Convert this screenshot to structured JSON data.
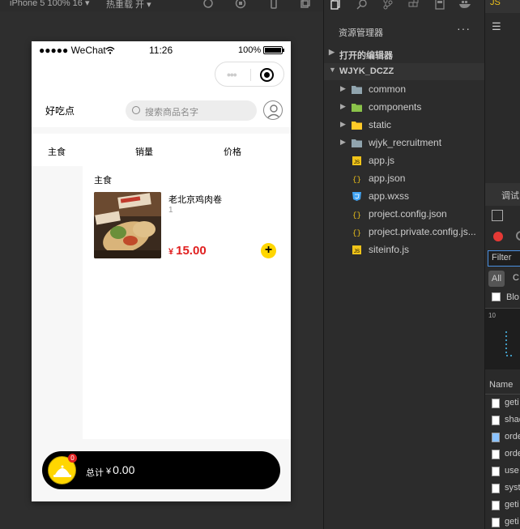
{
  "simulator": {
    "device_label": "iPhone 5 100% 16 ▾",
    "hot_reload_label": "热重载 开 ▾"
  },
  "phone": {
    "status": {
      "carrier": "●●●●● WeChat",
      "time": "11:26",
      "battery": "100%",
      "battery_level": 1.0
    },
    "header": {
      "brand": "好吃点",
      "search_placeholder": "搜索商品名字"
    },
    "sort_tabs": [
      "主食",
      "销量",
      "价格"
    ],
    "category_title": "主食",
    "item": {
      "name": "老北京鸡肉卷",
      "sales": "1",
      "currency": "¥",
      "price": "15.00",
      "add_label": "+"
    },
    "cart": {
      "badge": "0",
      "total_label": "总计",
      "currency": "¥",
      "total": "0.00"
    }
  },
  "explorer": {
    "title": "资源管理器",
    "more": "···",
    "open_editors": "打开的编辑器",
    "project": "WJYK_DCZZ",
    "tree": [
      {
        "label": "common",
        "type": "folder",
        "icon_color": "#90a4ae"
      },
      {
        "label": "components",
        "type": "folder",
        "icon_color": "#8bc34a"
      },
      {
        "label": "static",
        "type": "folder",
        "icon_color": "#ffca28"
      },
      {
        "label": "wjyk_recruitment",
        "type": "folder",
        "icon_color": "#90a4ae"
      },
      {
        "label": "app.js",
        "type": "js",
        "icon_color": "#f0c419"
      },
      {
        "label": "app.json",
        "type": "json",
        "icon_color": "#f0c419"
      },
      {
        "label": "app.wxss",
        "type": "css",
        "icon_color": "#42a5f5"
      },
      {
        "label": "project.config.json",
        "type": "json",
        "icon_color": "#f0c419"
      },
      {
        "label": "project.private.config.js...",
        "type": "json",
        "icon_color": "#f0c419"
      },
      {
        "label": "siteinfo.js",
        "type": "js",
        "icon_color": "#f0c419"
      }
    ]
  },
  "debugger": {
    "tab": "调试",
    "filter": "Filter",
    "all": "All",
    "blob": "Blo",
    "name_header": "Name",
    "requests": [
      "geti",
      "shac",
      "orde",
      "orde",
      "use",
      "syst",
      "geti",
      "geti"
    ]
  },
  "colors": {
    "accent_yellow": "#ffd600",
    "price_red": "#e02020",
    "cart_black": "#000000"
  }
}
